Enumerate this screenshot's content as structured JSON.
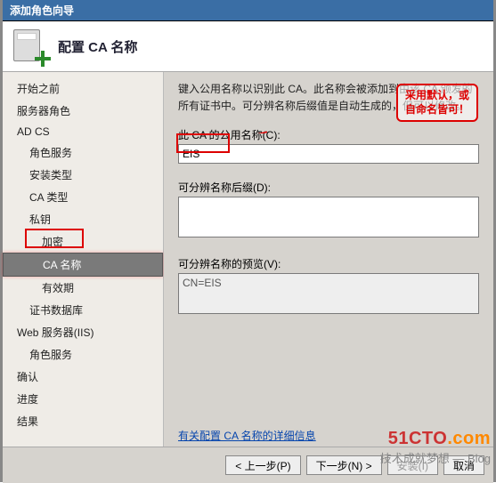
{
  "title": "添加角色向导",
  "header": {
    "title": "配置 CA 名称"
  },
  "sidebar": {
    "items": [
      {
        "label": "开始之前",
        "cls": "leaf"
      },
      {
        "label": "服务器角色",
        "cls": "leaf"
      },
      {
        "label": "AD CS",
        "cls": "leaf"
      },
      {
        "label": "角色服务",
        "cls": "leaf sub"
      },
      {
        "label": "安装类型",
        "cls": "leaf sub"
      },
      {
        "label": "CA 类型",
        "cls": "leaf sub"
      },
      {
        "label": "私钥",
        "cls": "leaf sub"
      },
      {
        "label": "加密",
        "cls": "leaf sub2"
      },
      {
        "label": "CA 名称",
        "cls": "leaf sub2 active"
      },
      {
        "label": "有效期",
        "cls": "leaf sub2"
      },
      {
        "label": "证书数据库",
        "cls": "leaf sub"
      },
      {
        "label": "Web 服务器(IIS)",
        "cls": "leaf"
      },
      {
        "label": "角色服务",
        "cls": "leaf sub"
      },
      {
        "label": "确认",
        "cls": "leaf"
      },
      {
        "label": "进度",
        "cls": "leaf"
      },
      {
        "label": "结果",
        "cls": "leaf"
      }
    ]
  },
  "content": {
    "desc": "键入公用名称以识别此 CA。此名称会被添加到由该 CA 颁发的所有证书中。可分辨名称后缀值是自动生成的，但可以修改。",
    "common_name_label": "此 CA 的公用名称(C):",
    "common_name_value": "EIS",
    "suffix_label": "可分辨名称后缀(D):",
    "suffix_value": "",
    "preview_label": "可分辨名称的预览(V):",
    "preview_value": "CN=EIS",
    "link": "有关配置 CA 名称的详细信息"
  },
  "callout": {
    "line1": "采用默认，或",
    "line2": "自命名皆可！"
  },
  "footer": {
    "prev": "< 上一步(P)",
    "next": "下一步(N) >",
    "install": "安装(I)",
    "cancel": "取消"
  },
  "watermark": {
    "brand_a": "51CTO",
    "brand_b": ".com",
    "sub": "技术成就梦想 — Blog"
  }
}
